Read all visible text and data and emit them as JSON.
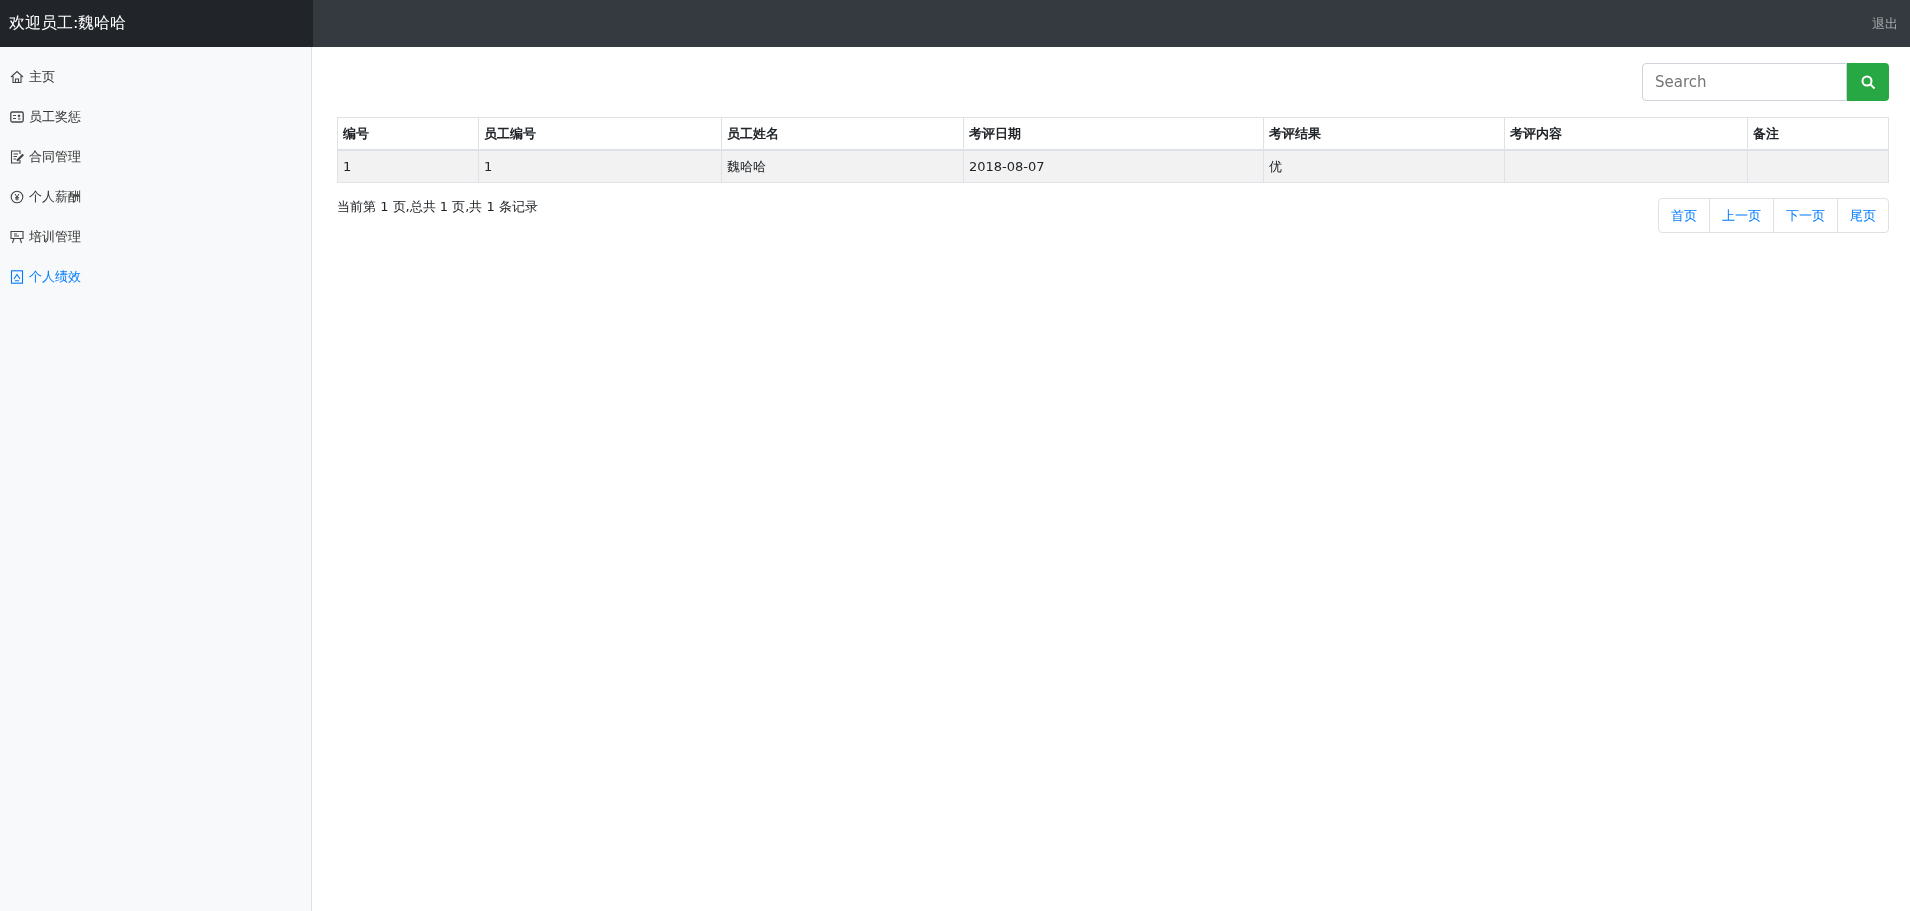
{
  "header": {
    "welcome": "欢迎员工:魏哈哈",
    "logout": "退出"
  },
  "sidebar": {
    "items": [
      {
        "label": "主页",
        "selected": false
      },
      {
        "label": "员工奖惩",
        "selected": false
      },
      {
        "label": "合同管理",
        "selected": false
      },
      {
        "label": "个人薪酬",
        "selected": false
      },
      {
        "label": "培训管理",
        "selected": false
      },
      {
        "label": "个人绩效",
        "selected": true
      }
    ]
  },
  "search": {
    "placeholder": "Search"
  },
  "table": {
    "columns": [
      "编号",
      "员工编号",
      "员工姓名",
      "考评日期",
      "考评结果",
      "考评内容",
      "备注"
    ],
    "rows": [
      [
        "1",
        "1",
        "魏哈哈",
        "2018-08-07",
        "优",
        "",
        ""
      ]
    ]
  },
  "pagination": {
    "summary": "当前第 1 页,总共 1 页,共 1 条记录",
    "buttons": [
      "首页",
      "上一页",
      "下一页",
      "尾页"
    ]
  }
}
